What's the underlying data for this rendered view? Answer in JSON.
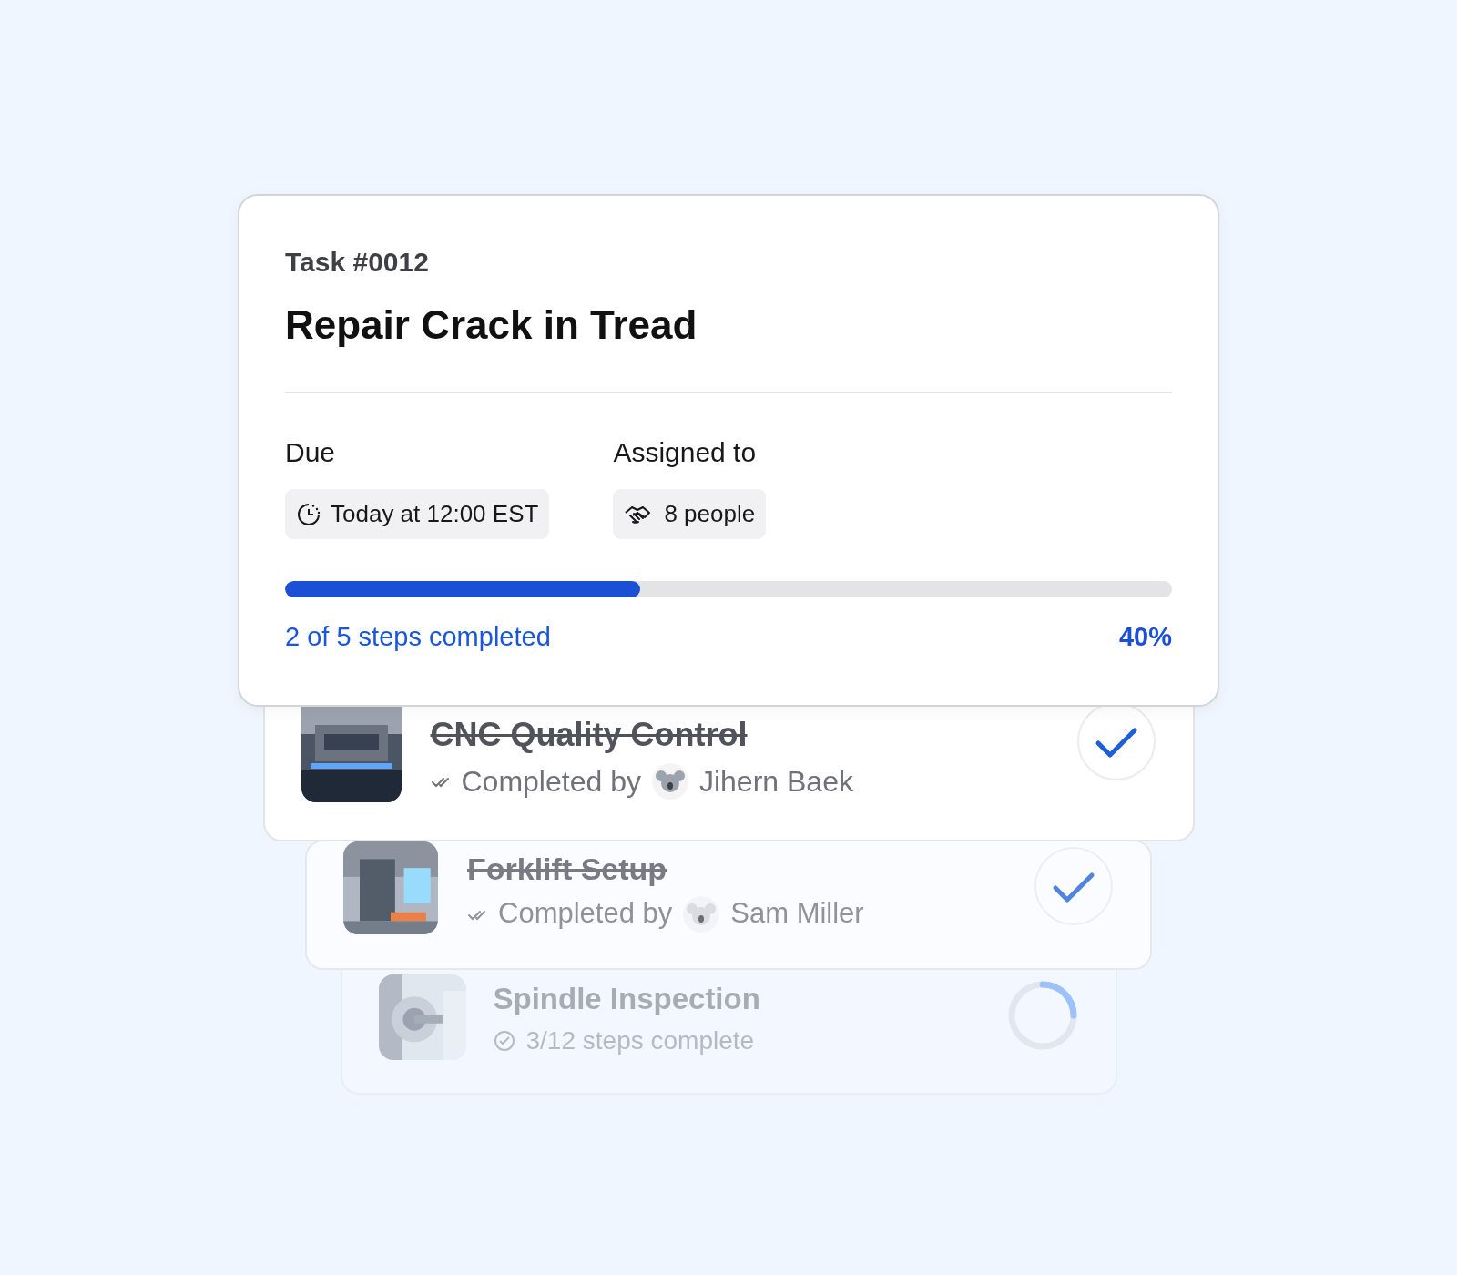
{
  "task": {
    "number": "Task #0012",
    "title": "Repair Crack in Tread"
  },
  "due": {
    "label": "Due",
    "value": "Today at 12:00 EST"
  },
  "assigned": {
    "label": "Assigned to",
    "value": "8 people"
  },
  "progress": {
    "level": 0.4,
    "caption": "2 of 5 steps completed",
    "percent": "40%"
  },
  "steps": [
    {
      "title": "CNC Quality Control",
      "completed": true,
      "status": "Completed by",
      "person": "Jihern Baek"
    },
    {
      "title": "Forklift Setup",
      "completed": true,
      "status": "Completed by",
      "person": "Sam Miller"
    },
    {
      "title": "Spindle Inspection",
      "completed": false,
      "status": "3/12 steps complete",
      "level": 0.25
    }
  ]
}
